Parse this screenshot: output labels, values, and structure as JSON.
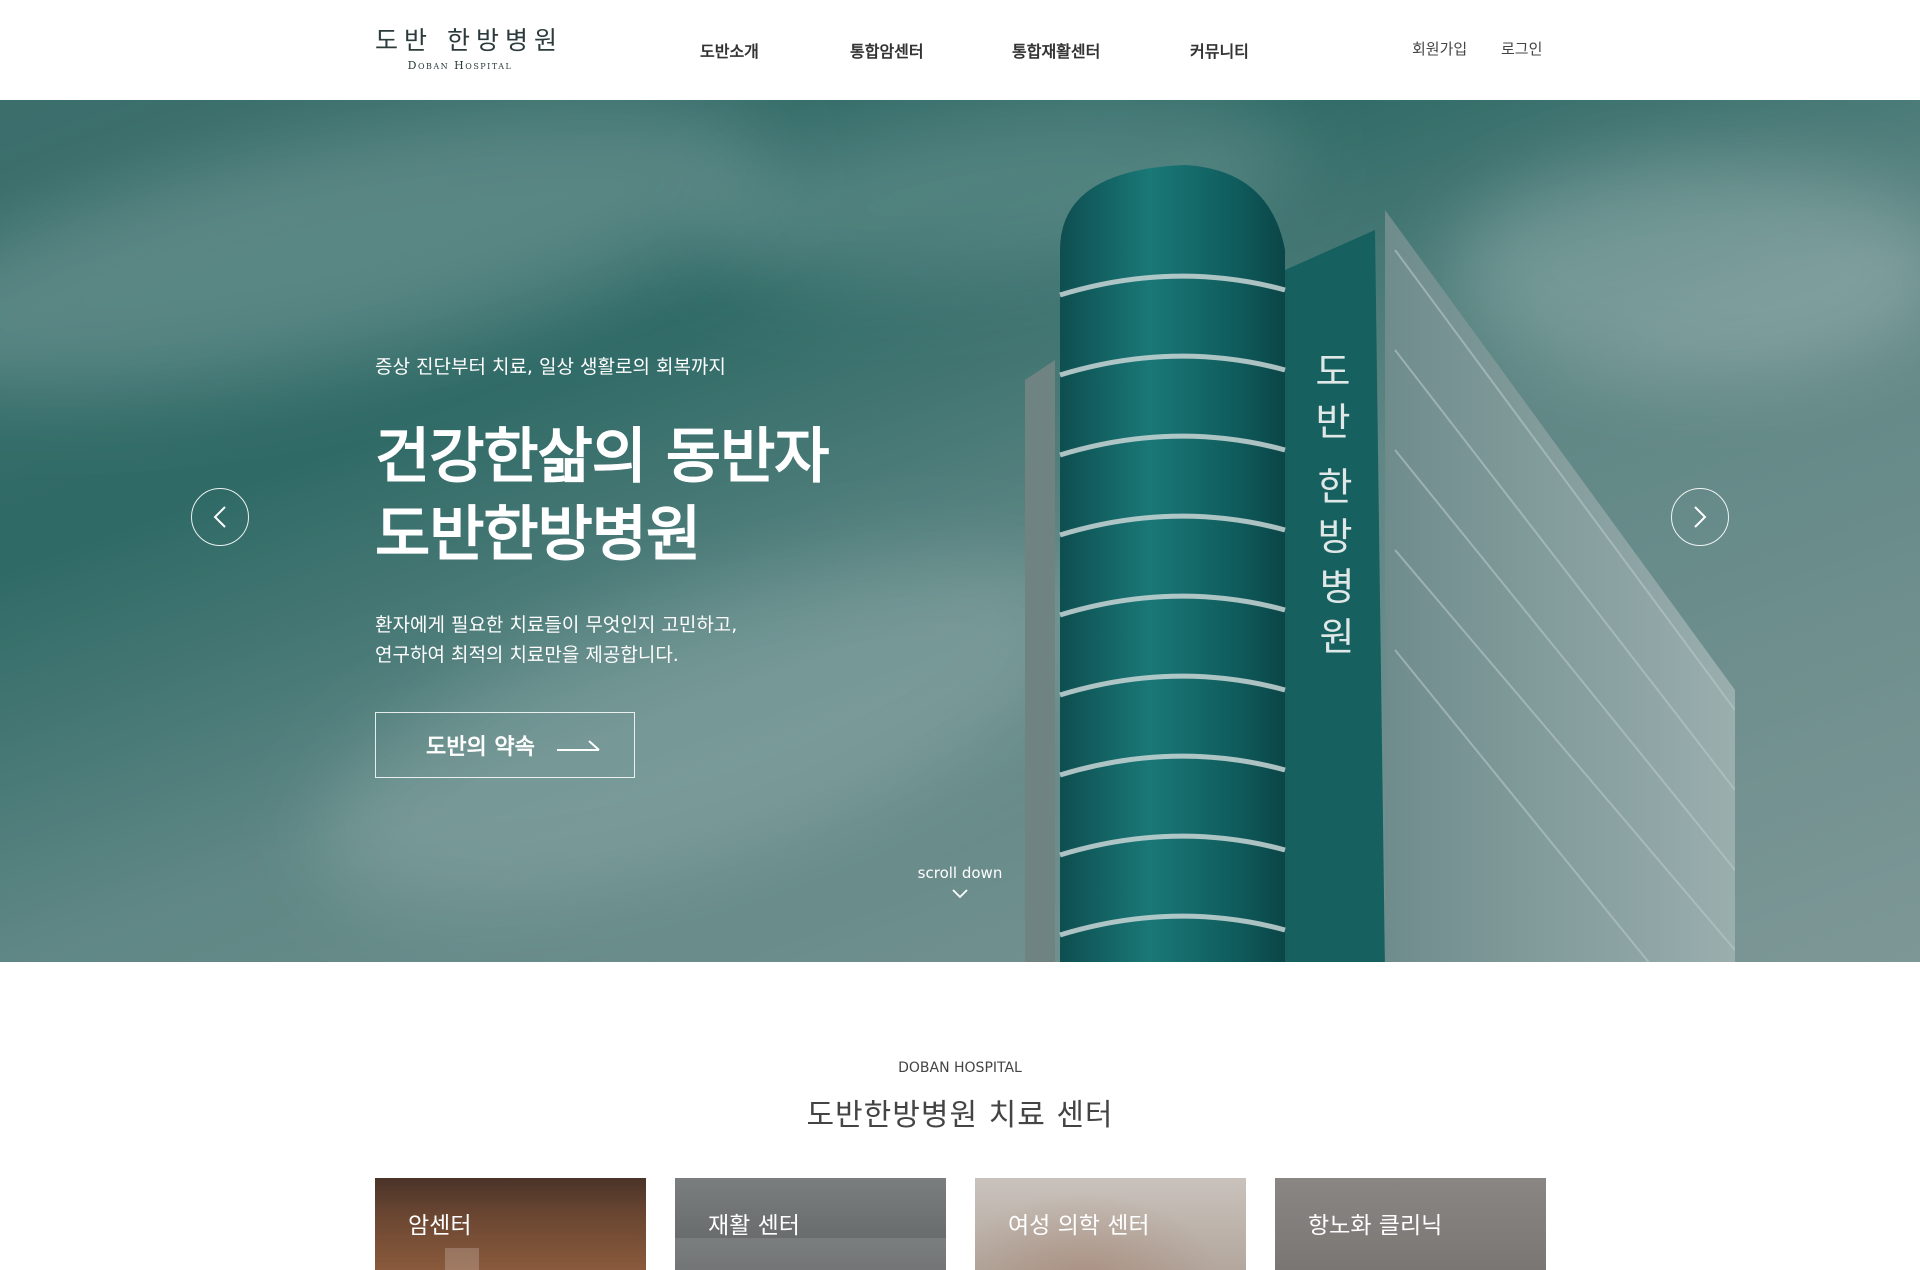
{
  "header": {
    "logo_ko": "도반 한방병원",
    "logo_en": "Doban Hospital",
    "nav": [
      {
        "label": "도반소개"
      },
      {
        "label": "통합암센터"
      },
      {
        "label": "통합재활센터"
      },
      {
        "label": "커뮤니티"
      }
    ],
    "signup": "회원가입",
    "login": "로그인"
  },
  "hero": {
    "subtitle": "증상 진단부터 치료, 일상 생활로의 회복까지",
    "title_line1": "건강한삶의 동반자",
    "title_line2": "도반한방병원",
    "desc_line1": "환자에게 필요한 치료들이 무엇인지 고민하고,",
    "desc_line2": "연구하여 최적의 치료만을 제공합니다.",
    "button": "도반의 약속",
    "scroll": "scroll down",
    "building_sign": [
      "도",
      "반",
      "한",
      "방",
      "병",
      "원"
    ]
  },
  "section": {
    "eyebrow": "DOBAN HOSPITAL",
    "title": "도반한방병원 치료 센터",
    "cards": [
      {
        "label": "암센터"
      },
      {
        "label": "재활 센터"
      },
      {
        "label": "여성 의학 센터"
      },
      {
        "label": "항노화 클리닉"
      }
    ]
  },
  "colors": {
    "hero_teal": "#2f6a66",
    "white": "#ffffff",
    "text_dark": "#333333"
  }
}
